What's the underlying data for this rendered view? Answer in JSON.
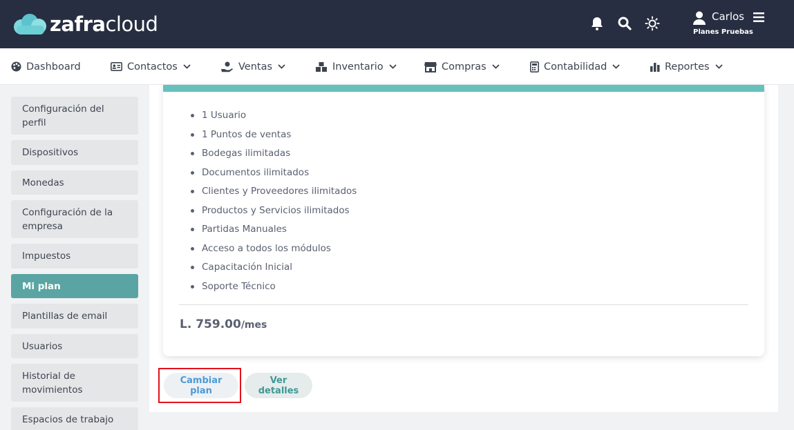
{
  "header": {
    "logo_bold": "zafra",
    "logo_light": "cloud",
    "user_name": "Carlos",
    "user_subtitle": "Planes Pruebas"
  },
  "nav": {
    "items": [
      {
        "label": "Dashboard",
        "icon": "palette-icon",
        "has_dropdown": false
      },
      {
        "label": "Contactos",
        "icon": "id-card-icon",
        "has_dropdown": true
      },
      {
        "label": "Ventas",
        "icon": "hand-holding-dollar-icon",
        "has_dropdown": true
      },
      {
        "label": "Inventario",
        "icon": "boxes-icon",
        "has_dropdown": true
      },
      {
        "label": "Compras",
        "icon": "store-icon",
        "has_dropdown": true
      },
      {
        "label": "Contabilidad",
        "icon": "calculator-icon",
        "has_dropdown": true
      },
      {
        "label": "Reportes",
        "icon": "bar-chart-icon",
        "has_dropdown": true
      }
    ]
  },
  "sidebar": {
    "items": [
      {
        "label": "Configuración del perfil"
      },
      {
        "label": "Dispositivos"
      },
      {
        "label": "Monedas"
      },
      {
        "label": "Configuración de la empresa"
      },
      {
        "label": "Impuestos"
      },
      {
        "label": "Mi plan"
      },
      {
        "label": "Plantillas de email"
      },
      {
        "label": "Usuarios"
      },
      {
        "label": "Historial de movimientos"
      },
      {
        "label": "Espacios de trabajo"
      }
    ],
    "active": "Mi plan"
  },
  "plan": {
    "features": [
      "1 Usuario",
      "1 Puntos de ventas",
      "Bodegas ilimitadas",
      "Documentos ilimitados",
      "Clientes y Proveedores ilimitados",
      "Productos y Servicios ilimitados",
      "Partidas Manuales",
      "Acceso a todos los módulos",
      "Capacitación Inicial",
      "Soporte Técnico"
    ],
    "price": "L. 759.00",
    "price_unit": "/mes"
  },
  "actions": {
    "change_plan": "Cambiar plan",
    "view_details": "Ver detalles"
  },
  "colors": {
    "header_bg": "#272e41",
    "accent_teal": "#66c1bd",
    "active_sidebar": "#5aa5a3",
    "link_blue": "#4e9ad6",
    "highlight_red": "#e3111b"
  }
}
